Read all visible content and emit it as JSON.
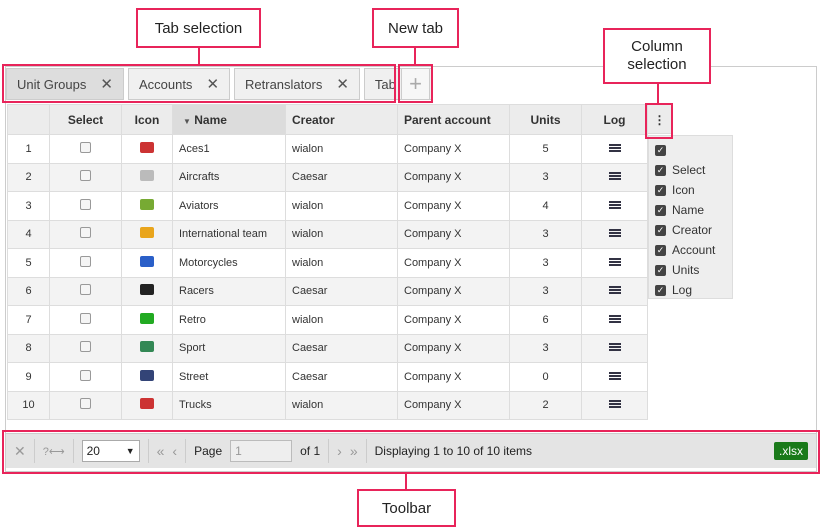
{
  "tabs": [
    {
      "label": "Unit Groups",
      "active": true
    },
    {
      "label": "Accounts"
    },
    {
      "label": "Retranslators"
    },
    {
      "label": "Tab"
    }
  ],
  "new_tab_label": "+",
  "columns": {
    "select": "Select",
    "icon": "Icon",
    "name": "Name",
    "creator": "Creator",
    "parent": "Parent account",
    "units": "Units",
    "log": "Log"
  },
  "rows": [
    {
      "n": "1",
      "name": "Aces1",
      "creator": "wialon",
      "parent": "Company X",
      "units": "5",
      "color": "#c33"
    },
    {
      "n": "2",
      "name": "Aircrafts",
      "creator": "Caesar",
      "parent": "Company X",
      "units": "3",
      "color": "#bbb"
    },
    {
      "n": "3",
      "name": "Aviators",
      "creator": "wialon",
      "parent": "Company X",
      "units": "4",
      "color": "#7a3"
    },
    {
      "n": "4",
      "name": "International team",
      "creator": "wialon",
      "parent": "Company X",
      "units": "3",
      "color": "#e9a51c"
    },
    {
      "n": "5",
      "name": "Motorcycles",
      "creator": "wialon",
      "parent": "Company X",
      "units": "3",
      "color": "#2a5fc8"
    },
    {
      "n": "6",
      "name": "Racers",
      "creator": "Caesar",
      "parent": "Company X",
      "units": "3",
      "color": "#222"
    },
    {
      "n": "7",
      "name": "Retro",
      "creator": "wialon",
      "parent": "Company X",
      "units": "6",
      "color": "#2a2"
    },
    {
      "n": "8",
      "name": "Sport",
      "creator": "Caesar",
      "parent": "Company X",
      "units": "3",
      "color": "#385"
    },
    {
      "n": "9",
      "name": "Street",
      "creator": "Caesar",
      "parent": "Company X",
      "units": "0",
      "color": "#347"
    },
    {
      "n": "10",
      "name": "Trucks",
      "creator": "wialon",
      "parent": "Company X",
      "units": "2",
      "color": "#c33"
    }
  ],
  "column_menu": {
    "icon": "⋮",
    "items": [
      "Select",
      "Icon",
      "Name",
      "Creator",
      "Account",
      "Units",
      "Log"
    ]
  },
  "toolbar": {
    "page_size": "20",
    "page_label": "Page",
    "page_value": "1",
    "of_label": "of 1",
    "status": "Displaying 1 to 10 of 10 items",
    "export": ".xlsx"
  },
  "annotations": {
    "tab_selection": "Tab selection",
    "new_tab": "New tab",
    "column_selection": "Column selection",
    "toolbar": "Toolbar"
  }
}
